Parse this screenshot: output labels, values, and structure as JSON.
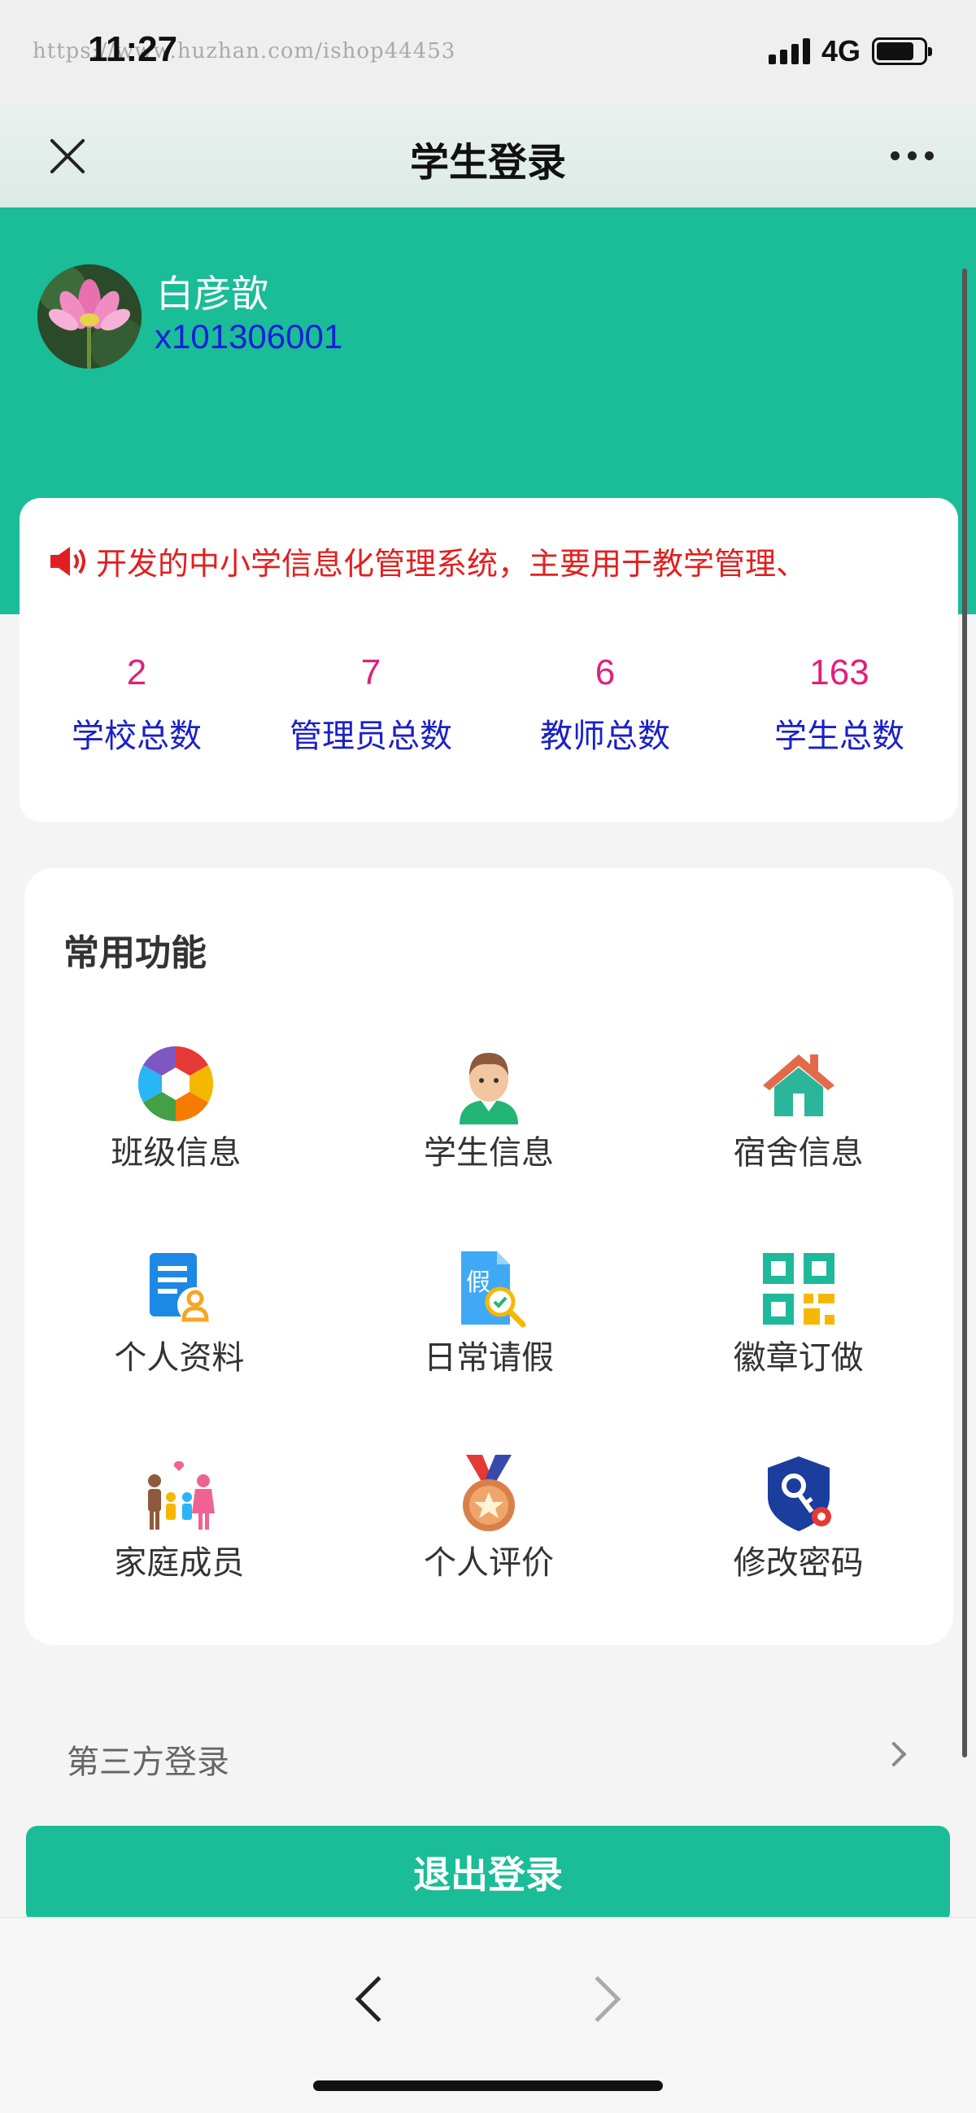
{
  "status_bar": {
    "watermark": "https://www.huzhan.com/ishop44453",
    "time": "11:27",
    "network": "4G",
    "battery_level": 0.8
  },
  "title_bar": {
    "title": "学生登录"
  },
  "user": {
    "name": "白彦歆",
    "id": "x101306001"
  },
  "notice": {
    "text": "开发的中小学信息化管理系统，主要用于教学管理、"
  },
  "stats": [
    {
      "value": "2",
      "label": "学校总数"
    },
    {
      "value": "7",
      "label": "管理员总数"
    },
    {
      "value": "6",
      "label": "教师总数"
    },
    {
      "value": "163",
      "label": "学生总数"
    }
  ],
  "functions": {
    "title": "常用功能",
    "items": [
      {
        "label": "班级信息",
        "icon": "aperture-icon"
      },
      {
        "label": "学生信息",
        "icon": "student-avatar-icon"
      },
      {
        "label": "宿舍信息",
        "icon": "house-icon"
      },
      {
        "label": "个人资料",
        "icon": "profile-doc-icon"
      },
      {
        "label": "日常请假",
        "icon": "leave-doc-icon"
      },
      {
        "label": "徽章订做",
        "icon": "qr-code-icon"
      },
      {
        "label": "家庭成员",
        "icon": "family-icon"
      },
      {
        "label": "个人评价",
        "icon": "medal-icon"
      },
      {
        "label": "修改密码",
        "icon": "key-shield-icon"
      }
    ]
  },
  "third_party": {
    "label": "第三方登录"
  },
  "logout": {
    "label": "退出登录"
  },
  "colors": {
    "brand_green": "#1bbc98",
    "notice_red": "#e02020",
    "stat_value_pink": "#e0207a",
    "stat_label_blue": "#1a20c8",
    "user_id_blue": "#1420d8"
  }
}
